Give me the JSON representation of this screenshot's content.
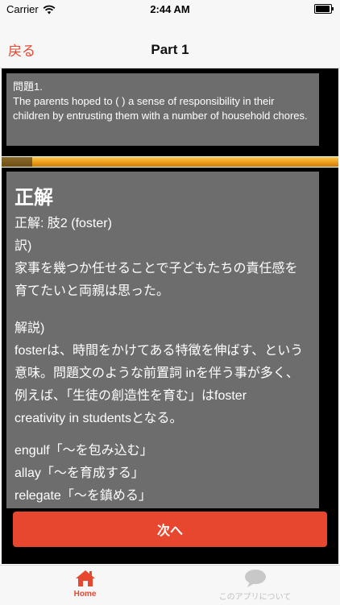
{
  "status_bar": {
    "carrier": "Carrier",
    "time": "2:44 AM"
  },
  "nav": {
    "back_label": "戻る",
    "title": "Part 1"
  },
  "question": {
    "number_label": "問題1.",
    "text": "The parents hoped to ( ) a sense of responsibility in their children by entrusting them with a number of household chores."
  },
  "progress": {
    "fraction": 0.09
  },
  "answer": {
    "heading": "正解",
    "correct": "正解: 肢2 (foster)",
    "translation_label": "訳)",
    "translation_lines": [
      "家事を幾つか任せることで子どもたちの責任感を",
      "育てたいと両親は思った。"
    ],
    "explanation_label": "解説)",
    "explanation_lines": [
      "fosterは、時間をかけてある特徴を伸ばす、という",
      "意味。問題文のような前置詞 inを伴う事が多く、",
      "例えば、「生徒の創造性を育む」はfoster",
      "creativity in studentsとなる。"
    ],
    "vocab": [
      "engulf「〜を包み込む」",
      "allay「〜を育成する」",
      "relegate「〜を鎮める」"
    ]
  },
  "next_button_label": "次へ",
  "tabs": [
    {
      "label": "Home",
      "icon": "home-icon",
      "active": true
    },
    {
      "label": "このアプリについて",
      "icon": "chat-bubble-icon",
      "active": false
    }
  ],
  "colors": {
    "accent": "#e8472f",
    "card": "#6d6d6d",
    "progress_bar": "#f0a020"
  }
}
